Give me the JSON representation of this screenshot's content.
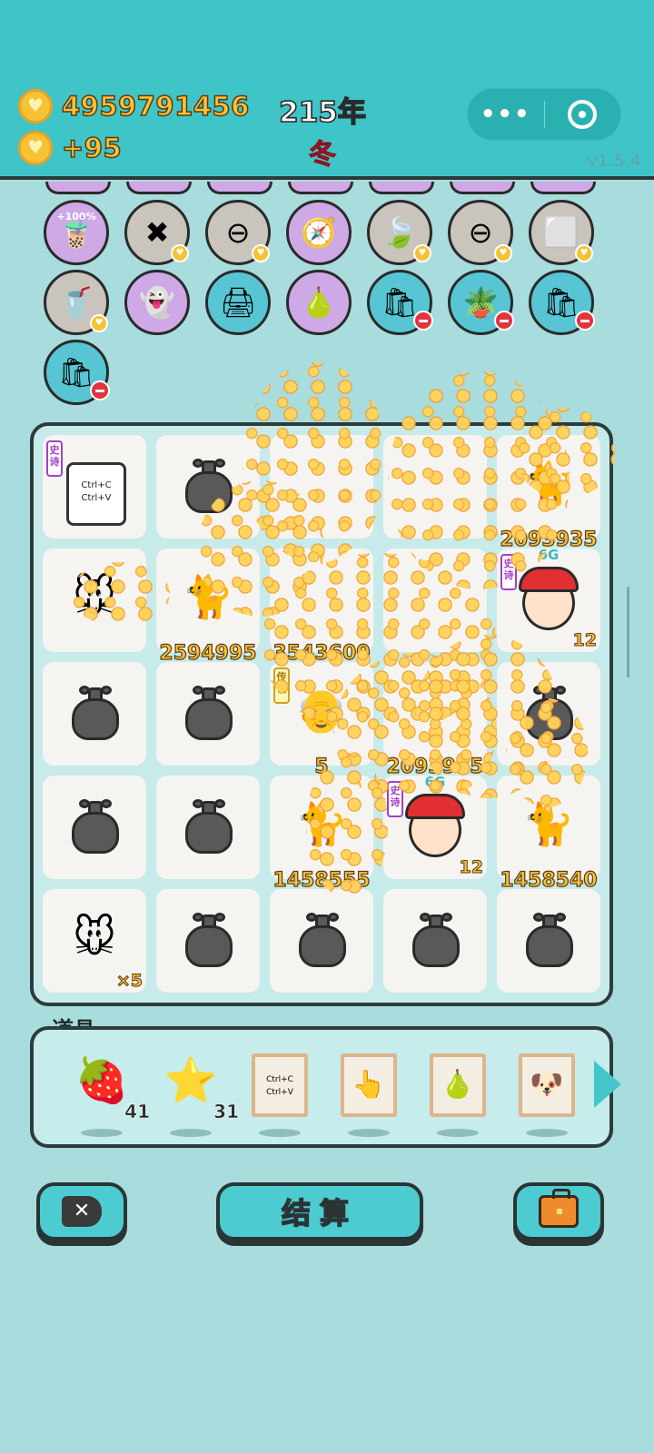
{
  "header": {
    "coins": "4959791456",
    "income": "+95",
    "year": "215年",
    "season": "冬",
    "version": "v1.5.4",
    "capsule_more": "•••"
  },
  "buffs_row1": [
    {
      "name": "bubble-tea-icon",
      "label": "+100%",
      "color": "purple",
      "glyph": "🧋"
    },
    {
      "name": "cancel-tag-icon",
      "color": "grey",
      "glyph": "✖"
    },
    {
      "name": "minus-circle-icon",
      "color": "grey",
      "glyph": "⊖"
    },
    {
      "name": "compass-icon",
      "color": "purple",
      "glyph": "🧭"
    },
    {
      "name": "leaf-icon",
      "color": "grey",
      "glyph": "🍃"
    },
    {
      "name": "minus-circle-icon",
      "color": "grey",
      "glyph": "⊖"
    },
    {
      "name": "sugar-cubes-icon",
      "color": "grey",
      "glyph": "⬜"
    }
  ],
  "buffs_row2": [
    {
      "name": "milk-tea-icon",
      "color": "grey",
      "glyph": "🥤"
    },
    {
      "name": "ghost-icon",
      "color": "purple",
      "glyph": "👻"
    },
    {
      "name": "printer-icon",
      "color": "teal",
      "glyph": "🖨"
    },
    {
      "name": "pomelo-icon",
      "color": "purple",
      "glyph": "🍐"
    },
    {
      "name": "sack-icon",
      "color": "teal",
      "glyph": "🛍"
    },
    {
      "name": "potted-plant-icon",
      "color": "teal",
      "glyph": "🪴"
    },
    {
      "name": "sack-icon",
      "color": "teal",
      "glyph": "🛍"
    }
  ],
  "buffs_row3": [
    {
      "name": "sack-icon",
      "color": "teal",
      "glyph": "🛍"
    }
  ],
  "board": {
    "cells": [
      {
        "kind": "keyboard",
        "tag": "史诗",
        "keys": "Ctrl+C\nCtrl+V"
      },
      {
        "kind": "bag"
      },
      {
        "kind": "coins"
      },
      {
        "kind": "coins"
      },
      {
        "kind": "cat",
        "value": "2093935"
      },
      {
        "kind": "mouse"
      },
      {
        "kind": "cat",
        "value": "2594995"
      },
      {
        "kind": "coins",
        "value": "3543600"
      },
      {
        "kind": "coins"
      },
      {
        "kind": "face",
        "tag": "史诗",
        "gen": "6G",
        "count": "12"
      },
      {
        "kind": "bag"
      },
      {
        "kind": "bag"
      },
      {
        "kind": "oldman",
        "tag": "传说",
        "value": "5"
      },
      {
        "kind": "coins",
        "value": "2093935"
      },
      {
        "kind": "bag"
      },
      {
        "kind": "bag"
      },
      {
        "kind": "bag"
      },
      {
        "kind": "cat",
        "value": "1458555"
      },
      {
        "kind": "face",
        "tag": "史诗",
        "gen": "6G",
        "count": "12"
      },
      {
        "kind": "cat",
        "value": "1458540"
      },
      {
        "kind": "mouse",
        "mult": "×5"
      },
      {
        "kind": "bag"
      },
      {
        "kind": "bag"
      },
      {
        "kind": "bag"
      },
      {
        "kind": "bag"
      }
    ]
  },
  "tools": {
    "title": "道具",
    "items": [
      {
        "name": "lychee-icon",
        "glyph": "🍓",
        "count": "41"
      },
      {
        "name": "star-icon",
        "glyph": "⭐",
        "count": "31"
      },
      {
        "name": "copy-paste-card-icon",
        "glyph": "Ctrl+C Ctrl+V"
      },
      {
        "name": "pointing-hand-card-icon",
        "glyph": "👆"
      },
      {
        "name": "pear-card-icon",
        "glyph": "🍐"
      },
      {
        "name": "dog-card-icon",
        "glyph": "🐶"
      }
    ]
  },
  "bottom": {
    "settle_label": "结算"
  },
  "colors": {
    "header_bg": "#3fc5c8",
    "body_bg": "#a9dcdc",
    "gold": "#f7c23a",
    "accent_red": "#ff4d5a"
  }
}
